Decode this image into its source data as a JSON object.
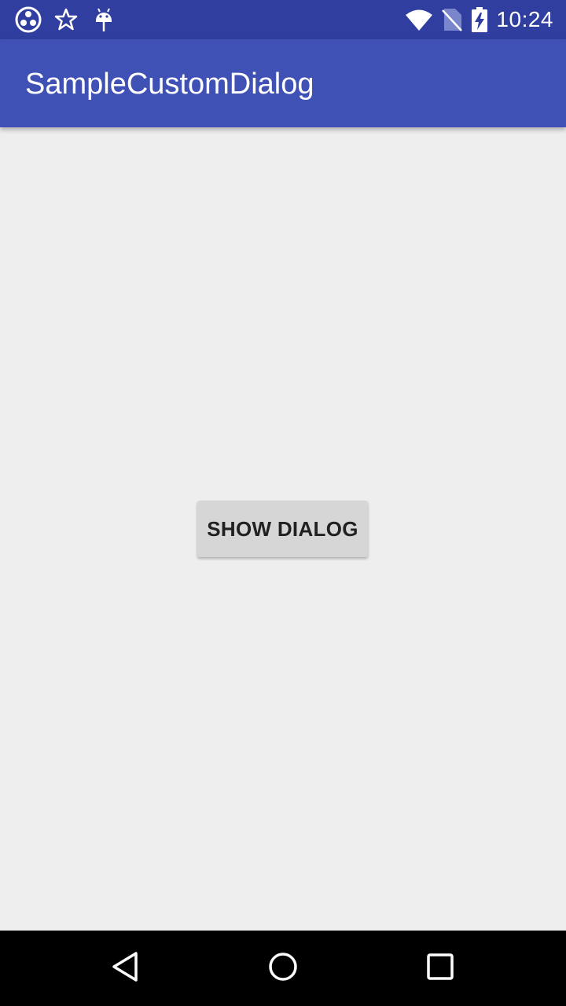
{
  "status_bar": {
    "time": "10:24",
    "left_icons": [
      "disc-icon",
      "star-icon",
      "android-icon"
    ],
    "right_icons": [
      "wifi-icon",
      "no-sim-icon",
      "battery-charging-icon"
    ]
  },
  "app_bar": {
    "title": "SampleCustomDialog"
  },
  "main": {
    "show_dialog_label": "SHOW DIALOG"
  },
  "nav_bar": {
    "buttons": [
      "back-icon",
      "home-icon",
      "recents-icon"
    ]
  },
  "colors": {
    "status_bar": "#303f9f",
    "app_bar": "#3f51b5",
    "background": "#eeeeee",
    "button": "#d6d6d6"
  }
}
